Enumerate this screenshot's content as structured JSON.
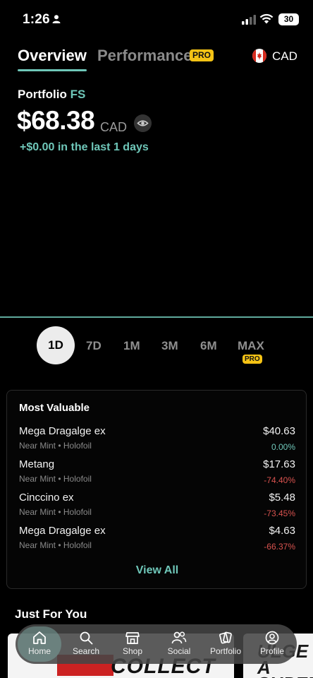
{
  "status_bar": {
    "time": "1:26",
    "battery": "30"
  },
  "header": {
    "tabs": [
      {
        "label": "Overview",
        "active": true
      },
      {
        "label": "Performance",
        "badge": "PRO"
      }
    ],
    "currency": "CAD"
  },
  "portfolio": {
    "label": "Portfolio",
    "suffix": "FS",
    "value": "$68.38",
    "currency": "CAD",
    "change": "+$0.00 in the last 1 days"
  },
  "ranges": [
    {
      "label": "1D",
      "active": true
    },
    {
      "label": "7D"
    },
    {
      "label": "1M"
    },
    {
      "label": "3M"
    },
    {
      "label": "6M"
    },
    {
      "label": "MAX",
      "badge": "PRO"
    }
  ],
  "most_valuable": {
    "title": "Most Valuable",
    "items": [
      {
        "name": "Mega Dragalge ex",
        "condition": "Near Mint • Holofoil",
        "price": "$40.63",
        "change": "0.00%",
        "direction": "flat"
      },
      {
        "name": "Metang",
        "condition": "Near Mint • Holofoil",
        "price": "$17.63",
        "change": "-74.40%",
        "direction": "down"
      },
      {
        "name": "Cinccino ex",
        "condition": "Near Mint • Holofoil",
        "price": "$5.48",
        "change": "-73.45%",
        "direction": "down"
      },
      {
        "name": "Mega Dragalge ex",
        "condition": "Near Mint • Holofoil",
        "price": "$4.63",
        "change": "-66.37%",
        "direction": "down"
      }
    ],
    "view_all": "View All"
  },
  "just_for_you": {
    "title": "Just For You",
    "promos": [
      {
        "text": "COLLECT"
      },
      {
        "text": "ULGE A SUPER G"
      }
    ]
  },
  "nav": {
    "items": [
      {
        "label": "Home",
        "icon": "home-icon",
        "active": true
      },
      {
        "label": "Search",
        "icon": "search-icon"
      },
      {
        "label": "Shop",
        "icon": "shop-icon"
      },
      {
        "label": "Social",
        "icon": "social-icon"
      },
      {
        "label": "Portfolio",
        "icon": "portfolio-icon"
      },
      {
        "label": "Profile",
        "icon": "profile-icon"
      }
    ]
  },
  "colors": {
    "accent": "#6fc7b9",
    "negative": "#d9534f",
    "pro": "#f5c315",
    "background": "#000000"
  }
}
